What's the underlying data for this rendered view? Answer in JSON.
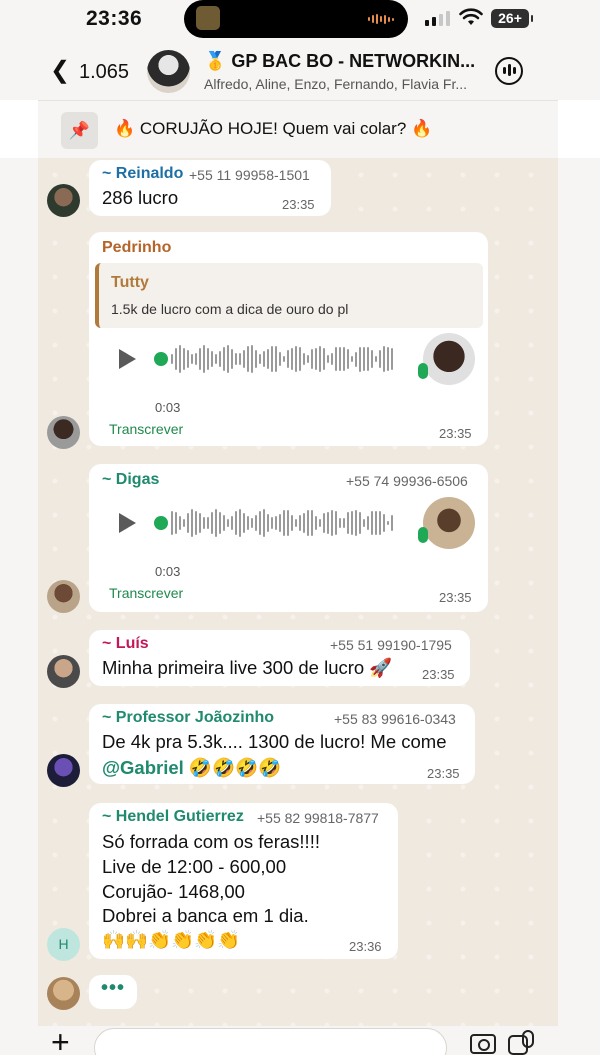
{
  "status_bar": {
    "time": "23:36",
    "battery": "26+"
  },
  "header": {
    "back_count": "1.065",
    "group_title": "🥇 GP BAC BO - NETWORKIN...",
    "members": "Alfredo, Aline, Enzo, Fernando, Flavia Fr..."
  },
  "pinned": {
    "text": "🔥 CORUJÃO HOJE! Quem vai colar? 🔥"
  },
  "messages": [
    {
      "sender": "~ Reinaldo",
      "phone": "+55 11 99958-1501",
      "text": "286 lucro",
      "time": "23:35"
    },
    {
      "sender": "Pedrinho",
      "quote_sender": "Tutty",
      "quote_text": "1.5k de lucro com a dica de ouro do pl",
      "duration": "0:03",
      "transcribe": "Transcrever",
      "time": "23:35"
    },
    {
      "sender": "~ Digas",
      "phone": "+55 74 99936-6506",
      "duration": "0:03",
      "transcribe": "Transcrever",
      "time": "23:35"
    },
    {
      "sender": "~ Luís",
      "phone": "+55 51 99190-1795",
      "text": "Minha primeira live 300 de lucro 🚀",
      "time": "23:35"
    },
    {
      "sender": "~ Professor Joãozinho",
      "phone": "+55 83 99616-0343",
      "line1": "De 4k pra 5.3k.... 1300 de lucro! Me come",
      "mention": "@Gabriel",
      "line2_emoji": " 🤣🤣🤣🤣",
      "time": "23:35"
    },
    {
      "sender": "~ Hendel Gutierrez",
      "phone": "+55 82 99818-7877",
      "lines": [
        "Só forrada com os feras!!!!",
        "Live de 12:00 - 600,00",
        "Corujão- 1468,00",
        "Dobrei a banca em 1 dia.",
        "🙌🙌👏👏👏👏"
      ],
      "time": "23:36",
      "avatar_letter": "H"
    }
  ],
  "typing": "•••",
  "colors": {
    "green": "#1fa855",
    "reinaldo": "#1d6fa5",
    "pedrinho": "#b5652a",
    "luis": "#c2185b",
    "teal": "#1f8a6e"
  }
}
